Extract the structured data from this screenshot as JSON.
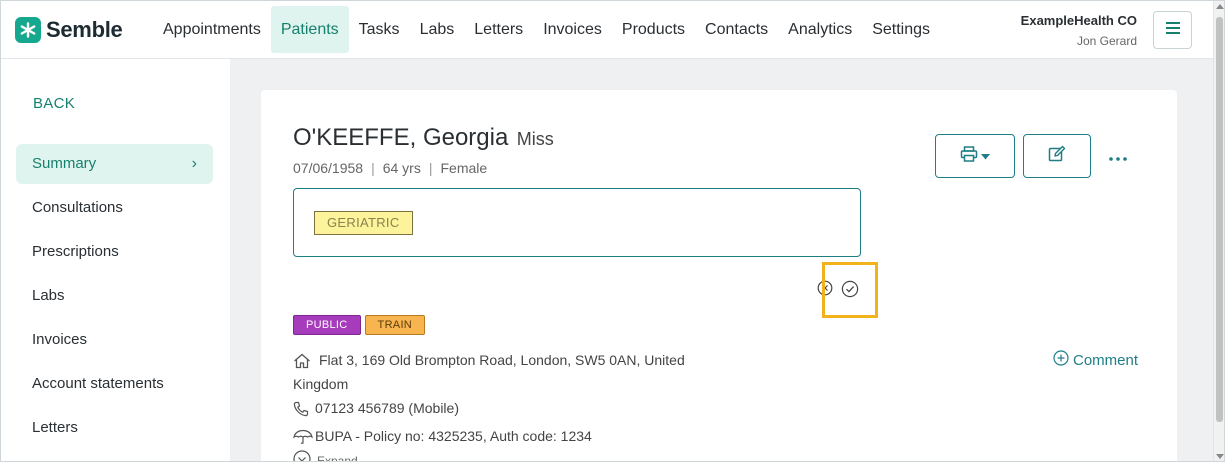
{
  "app": {
    "brand": "Semble"
  },
  "nav": {
    "items": [
      {
        "label": "Appointments"
      },
      {
        "label": "Patients"
      },
      {
        "label": "Tasks"
      },
      {
        "label": "Labs"
      },
      {
        "label": "Letters"
      },
      {
        "label": "Invoices"
      },
      {
        "label": "Products"
      },
      {
        "label": "Contacts"
      },
      {
        "label": "Analytics"
      },
      {
        "label": "Settings"
      }
    ],
    "active": "Patients"
  },
  "account": {
    "org": "ExampleHealth CO",
    "user": "Jon Gerard"
  },
  "sidebar": {
    "back_label": "BACK",
    "items": [
      {
        "label": "Summary"
      },
      {
        "label": "Consultations"
      },
      {
        "label": "Prescriptions"
      },
      {
        "label": "Labs"
      },
      {
        "label": "Invoices"
      },
      {
        "label": "Account statements"
      },
      {
        "label": "Letters"
      }
    ],
    "active": "Summary"
  },
  "patient": {
    "name": "O'KEEFFE, Georgia",
    "title": "Miss",
    "dob": "07/06/1958",
    "age": "64 yrs",
    "gender": "Female",
    "alert_tag": "GERIATRIC",
    "tags": [
      "PUBLIC",
      "TRAIN"
    ],
    "address": "Flat 3, 169 Old Brompton Road, London, SW5 0AN, United Kingdom",
    "phone": "07123 456789 (Mobile)",
    "insurance": "BUPA - Policy no: 4325235, Auth code: 1234",
    "comment_label": "Comment",
    "expand_label": "Expand"
  },
  "colors": {
    "accent": "#17806d",
    "brand": "#16a88e",
    "active_bg": "#dff4ef",
    "tag_public": "#a63cbb",
    "tag_train": "#f7b44f",
    "alert_tag_bg": "#fdf39a",
    "highlight": "#f2b21c"
  },
  "icons": [
    "semble-logo-icon",
    "hamburger-menu-icon",
    "chevron-right-icon",
    "printer-icon",
    "caret-down-icon",
    "edit-icon",
    "more-options-icon",
    "cancel-circle-icon",
    "confirm-check-icon",
    "home-icon",
    "phone-icon",
    "umbrella-icon",
    "plus-circle-icon",
    "expand-icon"
  ]
}
